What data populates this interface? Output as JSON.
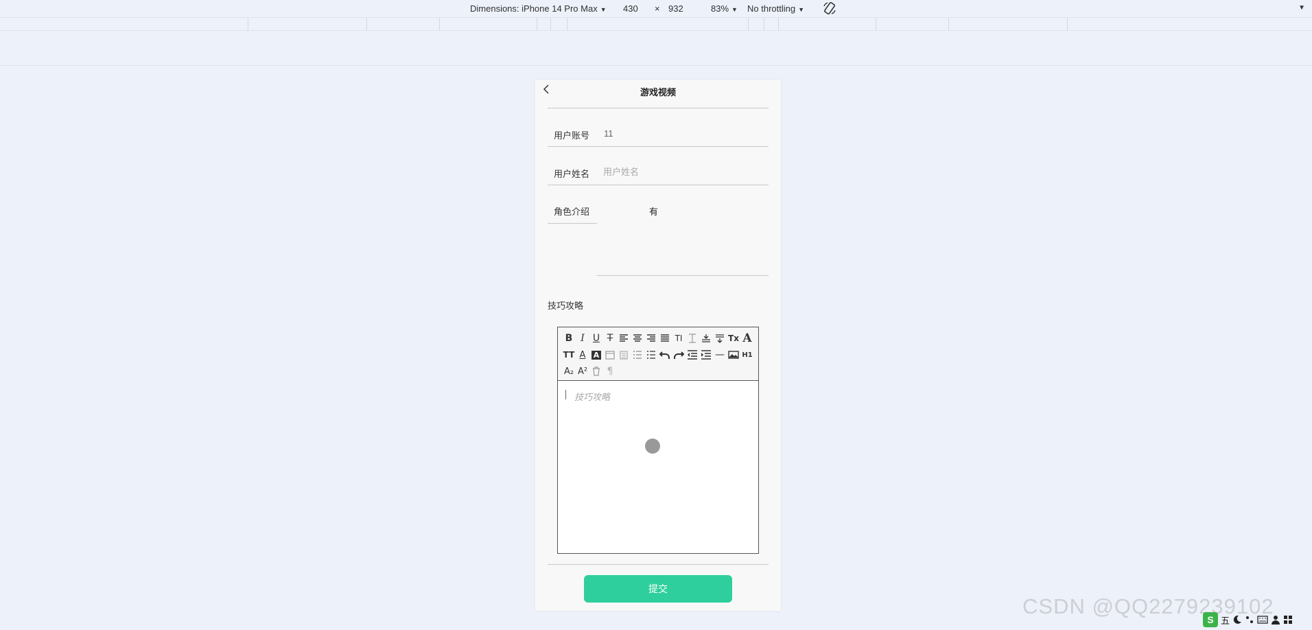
{
  "devtools": {
    "dimensions_label": "Dimensions: iPhone 14 Pro Max",
    "width": "430",
    "times": "×",
    "height": "932",
    "zoom": "83%",
    "throttling": "No throttling"
  },
  "page": {
    "title": "游戏视频"
  },
  "form": {
    "account_label": "用户账号",
    "account_value": "11",
    "name_label": "用户姓名",
    "name_placeholder": "用户姓名",
    "role_label": "角色介绍",
    "role_value": "有",
    "strategy_label": "技巧攻略",
    "editor_placeholder": "技巧攻略",
    "submit_label": "提交"
  },
  "toolbar": {
    "rows": [
      [
        "bold-icon",
        "italic-icon",
        "underline-icon",
        "strikethrough-icon",
        "align-left-icon",
        "align-center-icon",
        "align-right-icon",
        "align-justify-icon",
        "font-size-icon",
        "line-height-icon",
        "letter-spacing-icon",
        "paragraph-spacing-icon",
        "clear-format-icon",
        "font-icon"
      ],
      [
        "header-size-icon",
        "font-color-icon",
        "background-color-icon",
        "date-icon",
        "clipboard-icon",
        "ordered-list-icon",
        "unordered-list-icon",
        "undo-icon",
        "redo-icon",
        "outdent-icon",
        "indent-icon",
        "horizontal-rule-icon",
        "image-icon",
        "h1-icon"
      ],
      [
        "subscript-icon",
        "superscript-icon",
        "delete-icon",
        "paragraph-icon"
      ]
    ],
    "glyphs": {
      "bold": "B",
      "italic": "I",
      "underline": "U",
      "strike": "T",
      "font_size": "TI",
      "clear": "Tx",
      "font": "A",
      "header": "TT",
      "sub": "A₂",
      "sup": "A²",
      "para": "¶",
      "h1": "H1",
      "hr": "—"
    }
  },
  "watermark": "CSDN @QQ2279239102",
  "ime": {
    "logo": "S",
    "mode": "五",
    "icons": [
      "moon-icon",
      "punctuation-icon",
      "keyboard-icon",
      "user-icon",
      "grid-icon"
    ]
  }
}
